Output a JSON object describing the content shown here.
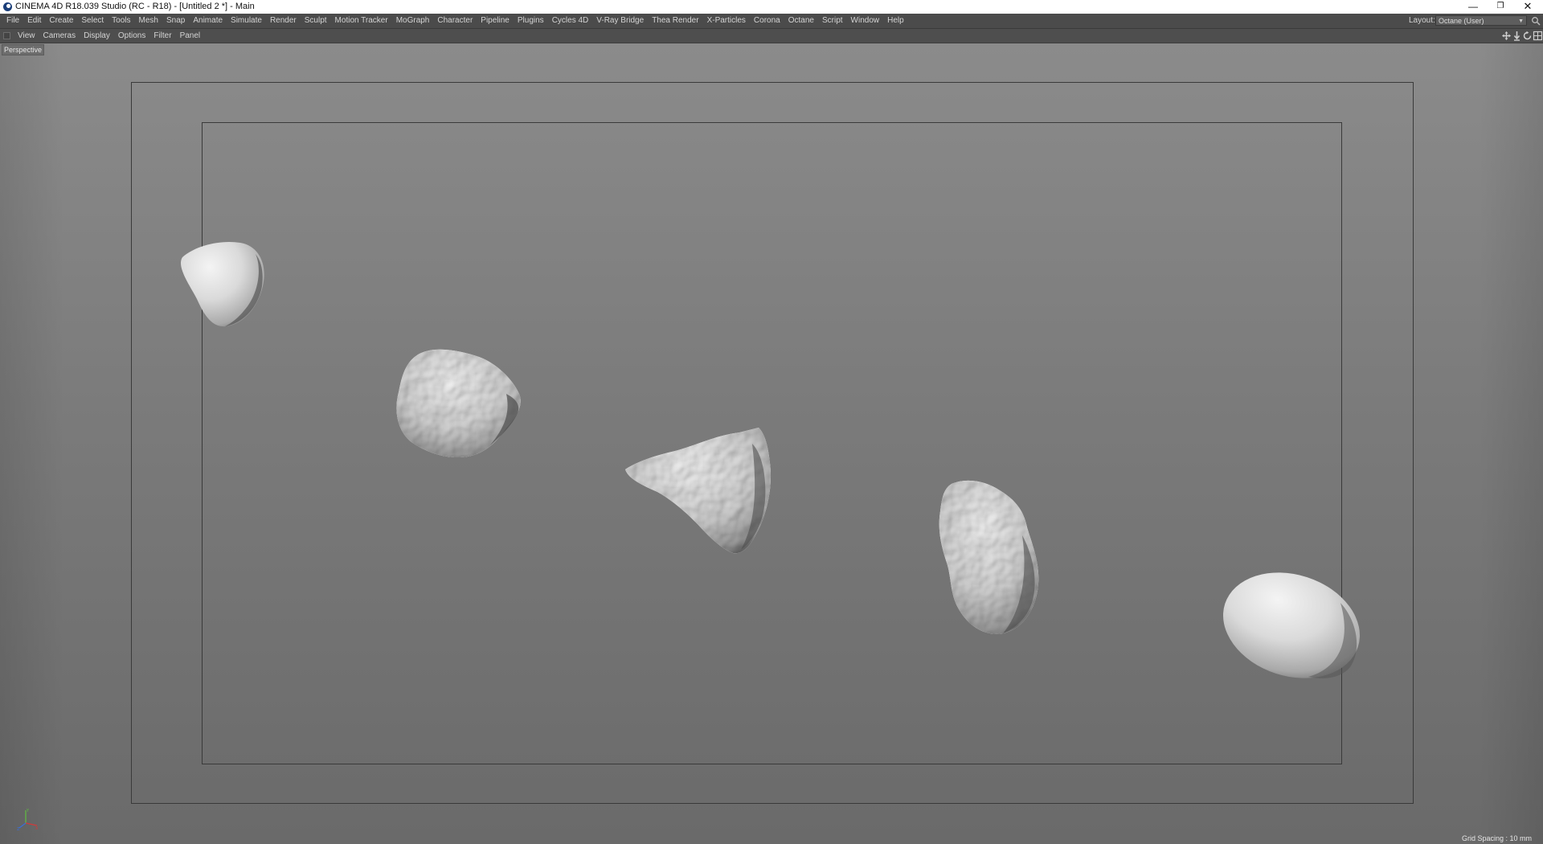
{
  "window": {
    "title": "CINEMA 4D R18.039 Studio (RC - R18) - [Untitled 2 *] - Main",
    "minimize_glyph": "—",
    "restore_glyph": "❐",
    "close_glyph": "✕"
  },
  "menubar": {
    "items": [
      "File",
      "Edit",
      "Create",
      "Select",
      "Tools",
      "Mesh",
      "Snap",
      "Animate",
      "Simulate",
      "Render",
      "Sculpt",
      "Motion Tracker",
      "MoGraph",
      "Character",
      "Pipeline",
      "Plugins",
      "Cycles 4D",
      "V-Ray Bridge",
      "Thea Render",
      "X-Particles",
      "Corona",
      "Octane",
      "Script",
      "Window",
      "Help"
    ],
    "layout_label": "Layout:",
    "layout_value": "Octane (User)"
  },
  "viewport_menu": {
    "items": [
      "View",
      "Cameras",
      "Display",
      "Options",
      "Filter",
      "Panel"
    ],
    "nav_icons": [
      "move-view-icon",
      "zoom-view-icon",
      "rotate-view-icon",
      "toggle-layout-icon"
    ]
  },
  "viewport": {
    "camera_label": "Perspective",
    "grid_spacing": "Grid Spacing : 10 mm",
    "axis_labels": {
      "x": "X",
      "y": "Y",
      "z": "Z"
    },
    "objects": [
      "rock-1",
      "rock-2",
      "rock-3",
      "rock-4",
      "rock-5"
    ],
    "colors": {
      "background_top": "#8b8b8b",
      "background_bottom": "#6a6a6a",
      "safe_frame": "#3a3a3a",
      "object_light": "#f0f0f0",
      "object_shadow": "#5a5a5a",
      "axis_x": "#d23a3a",
      "axis_y": "#5fbf3f",
      "axis_z": "#3a6fd8"
    }
  }
}
